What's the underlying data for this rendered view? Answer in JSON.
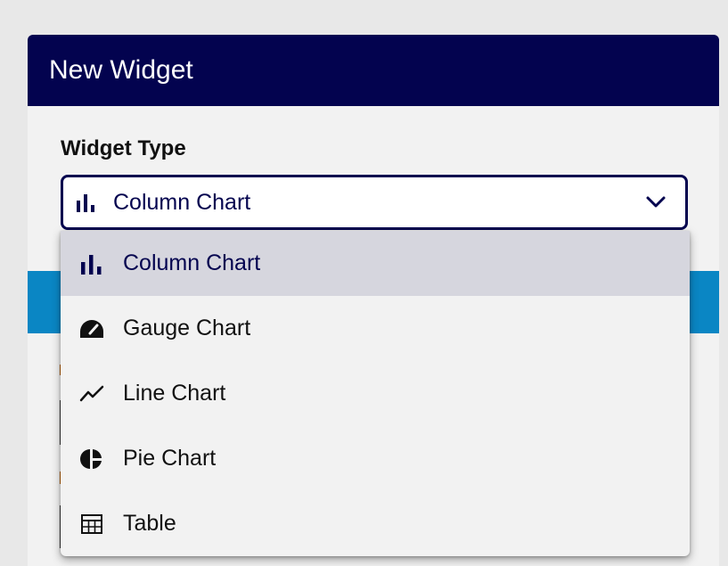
{
  "dialog": {
    "title": "New Widget"
  },
  "widget_type": {
    "label": "Widget Type",
    "selected_value": "Column Chart",
    "selected_icon": "column-chart-icon"
  },
  "dropdown": {
    "options": [
      {
        "label": "Column Chart",
        "icon": "column-chart-icon",
        "selected": true
      },
      {
        "label": "Gauge Chart",
        "icon": "gauge-icon",
        "selected": false
      },
      {
        "label": "Line Chart",
        "icon": "line-chart-icon",
        "selected": false
      },
      {
        "label": "Pie Chart",
        "icon": "pie-chart-icon",
        "selected": false
      },
      {
        "label": "Table",
        "icon": "table-icon",
        "selected": false
      }
    ]
  },
  "colors": {
    "header_bg": "#03034f",
    "accent": "#03034f",
    "section_band": "#0a86c4",
    "selected_option_bg": "#d6d6de"
  }
}
